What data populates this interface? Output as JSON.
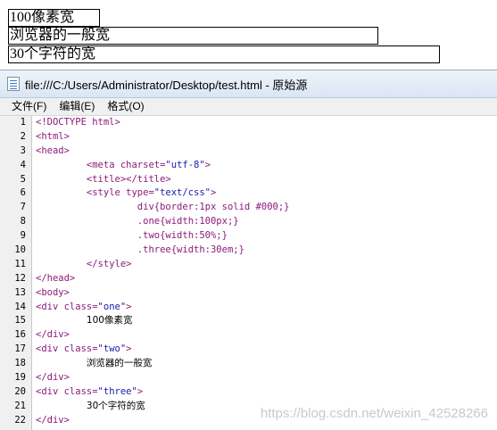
{
  "render": {
    "box_one": "100像素宽",
    "box_two": "浏览器的一般宽",
    "box_three": "30个字符的宽"
  },
  "window": {
    "title": "file:///C:/Users/Administrator/Desktop/test.html - 原始源",
    "icon": "document-icon"
  },
  "menu": [
    "文件(F)",
    "编辑(E)",
    "格式(O)"
  ],
  "source_lines": [
    {
      "n": "1",
      "segs": [
        [
          "t",
          "<!DOCTYPE html>"
        ]
      ]
    },
    {
      "n": "2",
      "segs": [
        [
          "t",
          "<html>"
        ]
      ]
    },
    {
      "n": "3",
      "segs": [
        [
          "t",
          "<head>"
        ]
      ]
    },
    {
      "n": "4",
      "segs": [
        [
          "s",
          "         "
        ],
        [
          "t",
          "<meta charset="
        ],
        [
          "v",
          "\"utf-8\""
        ],
        [
          "t",
          ">"
        ]
      ]
    },
    {
      "n": "5",
      "segs": [
        [
          "s",
          "         "
        ],
        [
          "t",
          "<title></title>"
        ]
      ]
    },
    {
      "n": "6",
      "segs": [
        [
          "s",
          "         "
        ],
        [
          "t",
          "<style type="
        ],
        [
          "v",
          "\"text/css\""
        ],
        [
          "t",
          ">"
        ]
      ]
    },
    {
      "n": "7",
      "segs": [
        [
          "s",
          "                  "
        ],
        [
          "c",
          "div{border:1px solid #000;}"
        ]
      ]
    },
    {
      "n": "8",
      "segs": [
        [
          "s",
          "                  "
        ],
        [
          "c",
          ".one{width:100px;}"
        ]
      ]
    },
    {
      "n": "9",
      "segs": [
        [
          "s",
          "                  "
        ],
        [
          "c",
          ".two{width:50%;}"
        ]
      ]
    },
    {
      "n": "10",
      "segs": [
        [
          "s",
          "                  "
        ],
        [
          "c",
          ".three{width:30em;}"
        ]
      ]
    },
    {
      "n": "11",
      "segs": [
        [
          "s",
          "         "
        ],
        [
          "t",
          "</style>"
        ]
      ]
    },
    {
      "n": "12",
      "segs": [
        [
          "t",
          "</head>"
        ]
      ]
    },
    {
      "n": "13",
      "segs": [
        [
          "t",
          "<body>"
        ]
      ]
    },
    {
      "n": "14",
      "segs": [
        [
          "t",
          "<div class="
        ],
        [
          "v",
          "\"one\""
        ],
        [
          "t",
          ">"
        ]
      ]
    },
    {
      "n": "15",
      "segs": [
        [
          "s",
          "         "
        ],
        [
          "x",
          "100像素宽"
        ]
      ]
    },
    {
      "n": "16",
      "segs": [
        [
          "t",
          "</div>"
        ]
      ]
    },
    {
      "n": "17",
      "segs": [
        [
          "t",
          "<div class="
        ],
        [
          "v",
          "\"two\""
        ],
        [
          "t",
          ">"
        ]
      ]
    },
    {
      "n": "18",
      "segs": [
        [
          "s",
          "         "
        ],
        [
          "x",
          "浏览器的一般宽"
        ]
      ]
    },
    {
      "n": "19",
      "segs": [
        [
          "t",
          "</div>"
        ]
      ]
    },
    {
      "n": "20",
      "segs": [
        [
          "t",
          "<div class="
        ],
        [
          "v",
          "\"three\""
        ],
        [
          "t",
          ">"
        ]
      ]
    },
    {
      "n": "21",
      "segs": [
        [
          "s",
          "         "
        ],
        [
          "x",
          "30个字符的宽"
        ]
      ]
    },
    {
      "n": "22",
      "segs": [
        [
          "t",
          "</div>"
        ]
      ]
    }
  ],
  "watermark": "https://blog.csdn.net/weixin_42528266"
}
